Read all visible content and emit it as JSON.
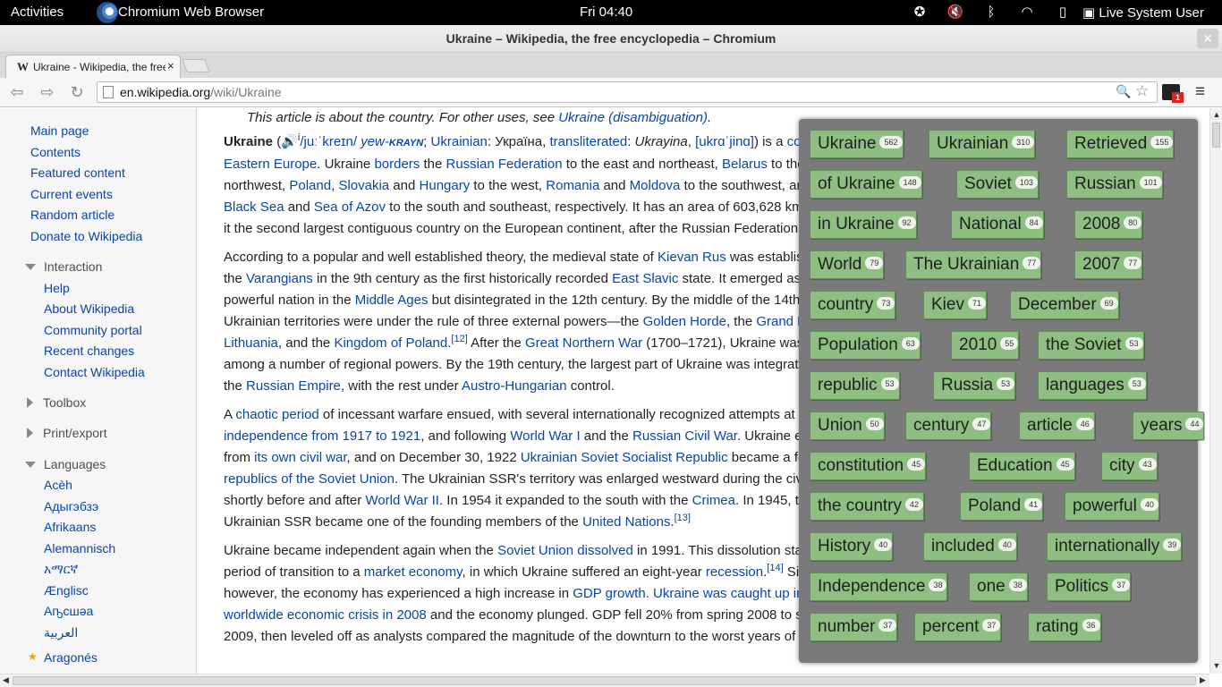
{
  "topbar": {
    "activities": "Activities",
    "app_name": "Chromium Web Browser",
    "clock": "Fri 04:40",
    "user": "Live System User",
    "tray_icons": [
      "accessibility-icon",
      "volume-muted-icon",
      "bluetooth-icon",
      "wifi-icon",
      "battery-icon"
    ]
  },
  "window": {
    "title": "Ukraine – Wikipedia, the free encyclopedia – Chromium",
    "close": "✕"
  },
  "tab": {
    "favicon": "W",
    "label": "Ukraine - Wikipedia, the free",
    "close": "×"
  },
  "toolbar": {
    "back": "⇦",
    "forward": "⇨",
    "reload": "↻",
    "url_host": "en.wikipedia.org",
    "url_path": "/wiki/Ukraine",
    "extension_badge": "1"
  },
  "sidebar": {
    "nav": [
      "Main page",
      "Contents",
      "Featured content",
      "Current events",
      "Random article",
      "Donate to Wikipedia"
    ],
    "interaction_heading": "Interaction",
    "interaction": [
      "Help",
      "About Wikipedia",
      "Community portal",
      "Recent changes",
      "Contact Wikipedia"
    ],
    "toolbox": "Toolbox",
    "print_export": "Print/export",
    "languages_heading": "Languages",
    "languages": [
      "Acèh",
      "Адыгэбзэ",
      "Afrikaans",
      "Alemannisch",
      "አማርኛ",
      "Ænglisc",
      "Аҧсшәа",
      "العربية",
      "Aragonés"
    ]
  },
  "article": {
    "hatnote_text": "This article is about the country. For other uses, see ",
    "hatnote_link": "Ukraine (disambiguation)",
    "p1": "<b>Ukraine</b> (<span style=\"color:#0645ad\">🔊</span><sup>i</sup><a>/juːˈkreɪn/</a> <a><i>yew-</i><b><i style=\"font-size:11px\">KRAYN</i></b></a>; <a>Ukrainian</a>: Україна, <a>transliterated</a>: <i>Ukrayina</i>, <a>[ukrɑˈjinɑ]</a>) is a <a>country</a> in <a>Eastern Europe</a>. Ukraine <a>borders</a> the <a>Russian Federation</a> to the east and northeast, <a>Belarus</a> to the northwest, <a>Poland</a>, <a>Slovakia</a> and <a>Hungary</a> to the west, <a>Romania</a> and <a>Moldova</a> to the southwest, and the <a>Black Sea</a> and <a>Sea of Azov</a> to the south and southeast, respectively. It has an area of 603,628 km², making it the second largest contiguous country on the European continent, after the Russian Federation.<sup><a>[9]</a><a>[10]</a><a>[11]</a></sup>",
    "p2": "According to a popular and well established theory, the medieval state of <a>Kievan Rus</a> was established by the <a>Varangians</a> in the 9th century as the first historically recorded <a>East Slavic</a> state. It emerged as a powerful nation in the <a>Middle Ages</a> but disintegrated in the 12th century. By the middle of the 14th century, Ukrainian territories were under the rule of three external powers—the <a>Golden Horde</a>, the <a>Grand Duchy of Lithuania</a>, and the <a>Kingdom of Poland</a>.<sup><a>[12]</a></sup> After the <a>Great Northern War</a> (1700–1721), Ukraine was divided among a number of regional powers. By the 19th century, the largest part of Ukraine was integrated into the <a>Russian Empire</a>, with the rest under <a>Austro-Hungarian</a> control.",
    "p3": "A <a>chaotic period</a> of incessant warfare ensued, with several internationally recognized attempts at <a>independence from 1917 to 1921</a>, and following <a>World War I</a> and the <a>Russian Civil War</a>. Ukraine emerged from <a>its own civil war</a>, and on December 30, 1922 <a>Ukrainian Soviet Socialist Republic</a> became a founding <a>republics of the Soviet Union</a>. The Ukrainian SSR's territory was enlarged westward during the civil war shortly before and after <a>World War II</a>. In 1954 it expanded to the south with the <a>Crimea</a>. In 1945, the Ukrainian SSR became one of the founding members of the <a>United Nations</a>.<sup><a>[13]</a></sup>",
    "p4": "Ukraine became independent again when the <a>Soviet Union dissolved</a> in 1991. This dissolution started a period of transition to a <a>market economy</a>, in which Ukraine suffered an eight-year <a>recession</a>.<sup><a>[14]</a></sup> Since then, however, the economy has experienced a high increase in <a>GDP growth</a>. <a>Ukraine was caught up in the worldwide economic crisis in 2008</a> and the economy plunged. GDP fell 20% from spring 2008 to spring 2009, then leveled off as analysts compared the magnitude of the downturn to the worst years of"
  },
  "word_cloud": [
    {
      "word": "Ukraine",
      "count": "562"
    },
    {
      "word": "Ukrainian",
      "count": "310"
    },
    {
      "word": "Retrieved",
      "count": "155"
    },
    {
      "word": "of Ukraine",
      "count": "148"
    },
    {
      "word": "Soviet",
      "count": "103"
    },
    {
      "word": "Russian",
      "count": "101"
    },
    {
      "word": "in Ukraine",
      "count": "92"
    },
    {
      "word": "National",
      "count": "84"
    },
    {
      "word": "2008",
      "count": "80"
    },
    {
      "word": "World",
      "count": "79"
    },
    {
      "word": "The Ukrainian",
      "count": "77"
    },
    {
      "word": "2007",
      "count": "77"
    },
    {
      "word": "country",
      "count": "73"
    },
    {
      "word": "Kiev",
      "count": "71"
    },
    {
      "word": "December",
      "count": "69"
    },
    {
      "word": "Population",
      "count": "63"
    },
    {
      "word": "2010",
      "count": "55"
    },
    {
      "word": "the Soviet",
      "count": "53"
    },
    {
      "word": "republic",
      "count": "53"
    },
    {
      "word": "Russia",
      "count": "53"
    },
    {
      "word": "languages",
      "count": "53"
    },
    {
      "word": "Union",
      "count": "50"
    },
    {
      "word": "century",
      "count": "47"
    },
    {
      "word": "article",
      "count": "46"
    },
    {
      "word": "years",
      "count": "44"
    },
    {
      "word": "constitution",
      "count": "45"
    },
    {
      "word": "Education",
      "count": "45"
    },
    {
      "word": "city",
      "count": "43"
    },
    {
      "word": "the country",
      "count": "42"
    },
    {
      "word": "Poland",
      "count": "41"
    },
    {
      "word": "powerful",
      "count": "40"
    },
    {
      "word": "History",
      "count": "40"
    },
    {
      "word": "included",
      "count": "40"
    },
    {
      "word": "internationally",
      "count": "39"
    },
    {
      "word": "Independence",
      "count": "38"
    },
    {
      "word": "one",
      "count": "38"
    },
    {
      "word": "Politics",
      "count": "37"
    },
    {
      "word": "number",
      "count": "37"
    },
    {
      "word": "percent",
      "count": "37"
    },
    {
      "word": "rating",
      "count": "36"
    }
  ]
}
